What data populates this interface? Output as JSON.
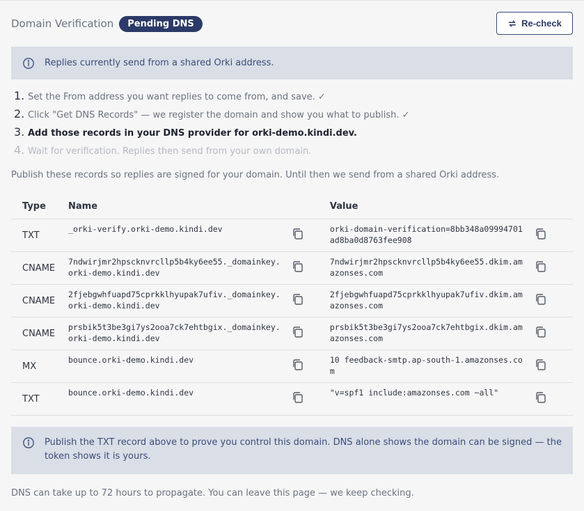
{
  "header": {
    "title": "Domain Verification",
    "badge": "Pending DNS",
    "recheck_label": "Re-check"
  },
  "info_top": {
    "text": "Replies currently send from a shared Orki address."
  },
  "steps": [
    {
      "num": "1.",
      "text": "Set the From address you want replies to come from, and save. ✓",
      "state": "done"
    },
    {
      "num": "2.",
      "text": "Click \"Get DNS Records\" — we register the domain and show you what to publish. ✓",
      "state": "done"
    },
    {
      "num": "3.",
      "text": "Add those records in your DNS provider for orki-demo.kindi.dev.",
      "state": "current"
    },
    {
      "num": "4.",
      "text": "Wait for verification. Replies then send from your own domain.",
      "state": "future"
    }
  ],
  "description": "Publish these records so replies are signed for your domain. Until then we send from a shared Orki address.",
  "table": {
    "headers": {
      "type": "Type",
      "name": "Name",
      "value": "Value"
    },
    "rows": [
      {
        "type": "TXT",
        "name": "_orki-verify.orki-demo.kindi.dev",
        "value": "orki-domain-verification=8bb348a09994701ad8ba0d8763fee908"
      },
      {
        "type": "CNAME",
        "name": "7ndwirjmr2hpscknvrcllp5b4ky6ee55._domainkey.orki-demo.kindi.dev",
        "value": "7ndwirjmr2hpscknvrcllp5b4ky6ee55.dkim.amazonses.com"
      },
      {
        "type": "CNAME",
        "name": "2fjebgwhfuapd75cprkklhyupak7ufiv._domainkey.orki-demo.kindi.dev",
        "value": "2fjebgwhfuapd75cprkklhyupak7ufiv.dkim.amazonses.com"
      },
      {
        "type": "CNAME",
        "name": "prsbik5t3be3gi7ys2ooa7ck7ehtbgix._domainkey.orki-demo.kindi.dev",
        "value": "prsbik5t3be3gi7ys2ooa7ck7ehtbgix.dkim.amazonses.com"
      },
      {
        "type": "MX",
        "name": "bounce.orki-demo.kindi.dev",
        "value": "10 feedback-smtp.ap-south-1.amazonses.com"
      },
      {
        "type": "TXT",
        "name": "bounce.orki-demo.kindi.dev",
        "value": "\"v=spf1 include:amazonses.com ~all\""
      }
    ]
  },
  "info_bottom": {
    "text": "Publish the TXT record above to prove you control this domain. DNS alone shows the domain can be signed — the token shows it is yours."
  },
  "footer": "DNS can take up to 72 hours to propagate. You can leave this page — we keep checking.",
  "icons": {
    "info": "info-circle-icon",
    "copy": "copy-icon",
    "recheck": "refresh-arrows-icon"
  },
  "colors": {
    "badge_bg": "#2b3a67",
    "info_bg": "#d9dee7",
    "info_text": "#3a4d7a"
  }
}
